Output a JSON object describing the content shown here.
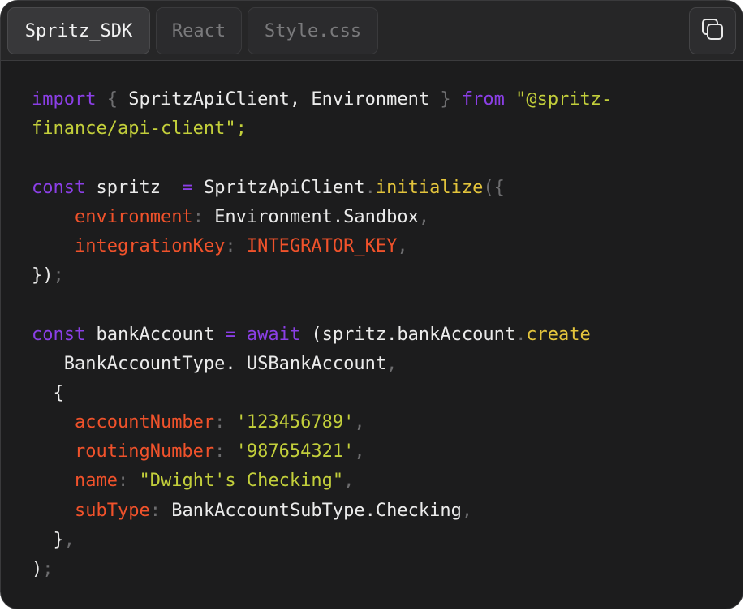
{
  "tabs": [
    {
      "label": "Spritz_SDK",
      "active": true
    },
    {
      "label": "React",
      "active": false
    },
    {
      "label": "Style.css",
      "active": false
    }
  ],
  "toolbar": {
    "copy_icon": "copy-icon"
  },
  "colors": {
    "background": "#1c1c1d",
    "keyword": "#8b3fe6",
    "string": "#c3cf3b",
    "function": "#e3c43c",
    "property": "#f0522b",
    "punctuation": "#6d6d6f",
    "text": "#ebebeb"
  },
  "code": {
    "lines": [
      [
        {
          "t": "import",
          "c": "kw"
        },
        {
          "t": " { ",
          "c": "pn"
        },
        {
          "t": "SpritzApiClient, Environment",
          "c": "tx"
        },
        {
          "t": " } ",
          "c": "pn"
        },
        {
          "t": "from",
          "c": "kw"
        },
        {
          "t": " \"@spritz-",
          "c": "str"
        }
      ],
      [
        {
          "t": "finance/api-client\"",
          "c": "str"
        },
        {
          "t": ";",
          "c": "str"
        }
      ],
      [],
      [
        {
          "t": "const",
          "c": "kw"
        },
        {
          "t": " spritz  ",
          "c": "tx"
        },
        {
          "t": "=",
          "c": "kw"
        },
        {
          "t": " SpritzApiClient",
          "c": "tx"
        },
        {
          "t": ".",
          "c": "pn"
        },
        {
          "t": "initialize",
          "c": "fn"
        },
        {
          "t": "({",
          "c": "pn"
        }
      ],
      [
        {
          "t": "    ",
          "c": "tx"
        },
        {
          "t": "environment",
          "c": "prop"
        },
        {
          "t": ": ",
          "c": "pn"
        },
        {
          "t": "Environment.Sandbox",
          "c": "tx"
        },
        {
          "t": ",",
          "c": "pn"
        }
      ],
      [
        {
          "t": "    ",
          "c": "tx"
        },
        {
          "t": "integrationKey",
          "c": "prop"
        },
        {
          "t": ": ",
          "c": "pn"
        },
        {
          "t": "INTEGRATOR_KEY",
          "c": "prop"
        },
        {
          "t": ",",
          "c": "pn"
        }
      ],
      [
        {
          "t": "})",
          "c": "tx"
        },
        {
          "t": ";",
          "c": "pn"
        }
      ],
      [],
      [
        {
          "t": "const",
          "c": "kw"
        },
        {
          "t": " bankAccount ",
          "c": "tx"
        },
        {
          "t": "=",
          "c": "kw"
        },
        {
          "t": " ",
          "c": "tx"
        },
        {
          "t": "await",
          "c": "kw"
        },
        {
          "t": " (spritz.bankAccount",
          "c": "tx"
        },
        {
          "t": ".",
          "c": "pn"
        },
        {
          "t": "create",
          "c": "fn"
        }
      ],
      [
        {
          "t": "   BankAccountType. USBankAccount",
          "c": "tx"
        },
        {
          "t": ",",
          "c": "pn"
        }
      ],
      [
        {
          "t": "  {",
          "c": "tx"
        }
      ],
      [
        {
          "t": "    ",
          "c": "tx"
        },
        {
          "t": "accountNumber",
          "c": "prop"
        },
        {
          "t": ": ",
          "c": "pn"
        },
        {
          "t": "'123456789'",
          "c": "str"
        },
        {
          "t": ",",
          "c": "pn"
        }
      ],
      [
        {
          "t": "    ",
          "c": "tx"
        },
        {
          "t": "routingNumber",
          "c": "prop"
        },
        {
          "t": ": ",
          "c": "pn"
        },
        {
          "t": "'987654321'",
          "c": "str"
        },
        {
          "t": ",",
          "c": "pn"
        }
      ],
      [
        {
          "t": "    ",
          "c": "tx"
        },
        {
          "t": "name",
          "c": "prop"
        },
        {
          "t": ": ",
          "c": "pn"
        },
        {
          "t": "\"Dwight's Checking\"",
          "c": "str"
        },
        {
          "t": ",",
          "c": "pn"
        }
      ],
      [
        {
          "t": "    ",
          "c": "tx"
        },
        {
          "t": "subType",
          "c": "prop"
        },
        {
          "t": ": ",
          "c": "pn"
        },
        {
          "t": "BankAccountSubType.Checking",
          "c": "tx"
        },
        {
          "t": ",",
          "c": "pn"
        }
      ],
      [
        {
          "t": "  }",
          "c": "tx"
        },
        {
          "t": ",",
          "c": "pn"
        }
      ],
      [
        {
          "t": ")",
          "c": "tx"
        },
        {
          "t": ";",
          "c": "pn"
        }
      ]
    ]
  }
}
